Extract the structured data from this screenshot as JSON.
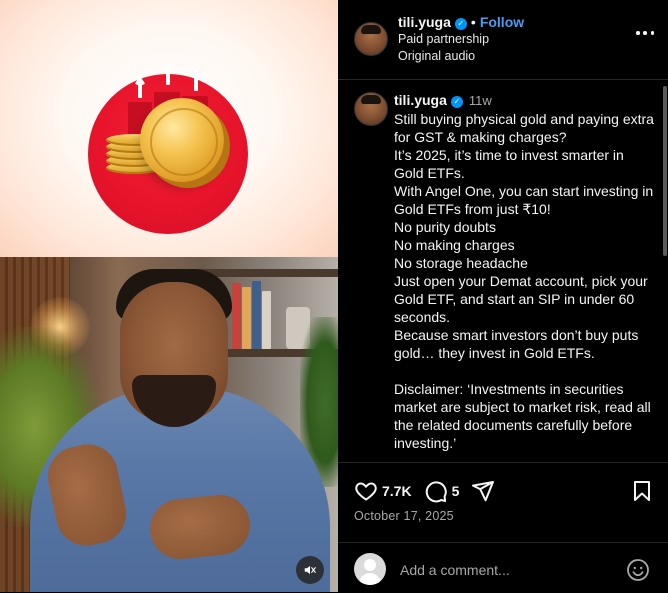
{
  "post": {
    "username": "tili.yuga",
    "follow_label": "Follow",
    "dot": "•",
    "partnership": "Paid partnership",
    "audio": "Original audio",
    "time_ago": "11w",
    "caption_lines": [
      "Still buying physical gold and paying extra for GST & making charges?",
      "It’s 2025, it’s time to invest smarter in Gold ETFs.",
      "With Angel One, you can start investing in Gold ETFs from just ₹10!",
      "No purity doubts",
      "No making charges",
      "No storage headache",
      "Just open your Demat account, pick your Gold ETF, and start an SIP in under 60 seconds.",
      "Because smart investors don’t buy puts gold… they invest in Gold ETFs.",
      "",
      "Disclaimer: ‘Investments in securities market are subject to market risk, read all the related documents carefully before investing.’"
    ],
    "likes": "7.7K",
    "comments_count": "5",
    "date": "October 17, 2025"
  },
  "comment_box": {
    "placeholder": "Add a comment..."
  },
  "icons": {
    "like": "heart-icon",
    "comment": "comment-icon",
    "share": "share-icon",
    "save": "bookmark-icon",
    "emoji": "emoji-icon",
    "mute": "muted-icon",
    "more": "more-options-icon",
    "verified": "verified-badge-icon"
  },
  "colors": {
    "accent": "#0095f6",
    "follow": "#4a9cf6",
    "background": "#000000",
    "coin_circle": "#e8142b"
  }
}
